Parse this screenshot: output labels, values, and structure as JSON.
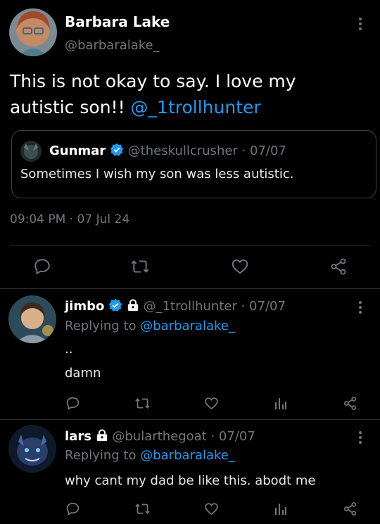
{
  "main_tweet": {
    "name": "Barbara Lake",
    "handle": "@barbaralake_",
    "text": "This is not okay to say. I love my autistic son!!",
    "mention": "@_1trollhunter",
    "time": "09:04 PM",
    "date": "07 Jul 24",
    "quote": {
      "name": "Gunmar",
      "handle": "@theskullcrusher",
      "date": "· 07/07",
      "text": "Sometimes I wish my son was less autistic."
    }
  },
  "replies": [
    {
      "name": "jimbo",
      "handle": "@_1trollhunter",
      "date": "· 07/07",
      "replying_prefix": "Replying to",
      "replying_to": "@barbaralake_",
      "text_line1": "..",
      "text_line2": "damn"
    },
    {
      "name": "lars",
      "handle": "@bularthegoat",
      "date": "· 07/07",
      "replying_prefix": "Replying to",
      "replying_to": "@barbaralake_",
      "text_line1": "why cant my dad be like this. abodt me"
    }
  ],
  "colors": {
    "accent": "#1d9bf0",
    "muted": "#71767b",
    "divider": "#2f3336",
    "background": "#000000"
  },
  "icons": [
    "reply-icon",
    "retweet-icon",
    "like-icon",
    "share-icon",
    "views-icon",
    "verified-icon",
    "lock-icon",
    "more-icon"
  ]
}
